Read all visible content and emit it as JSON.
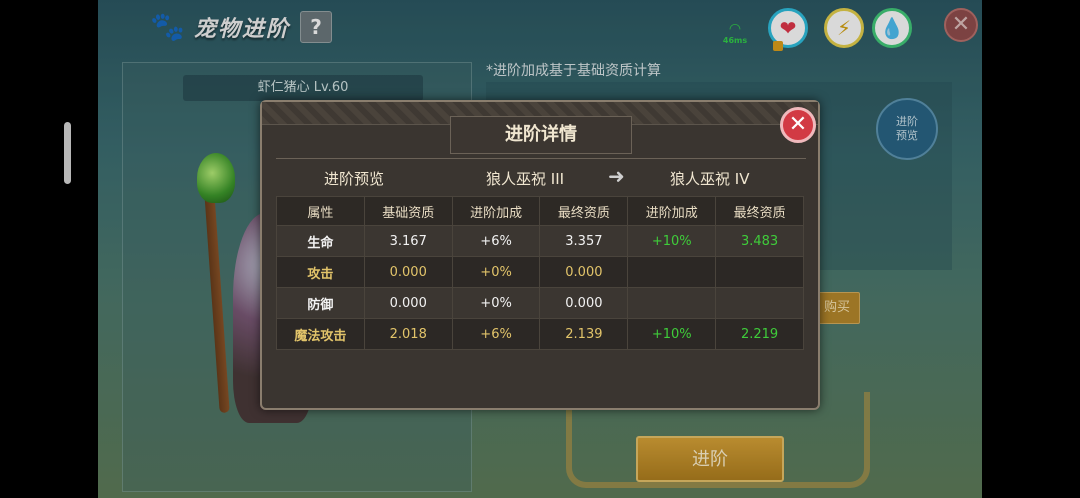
{
  "header": {
    "title": "宠物进阶",
    "help_label": "?",
    "ping": "46ms"
  },
  "status_icons": [
    "heart-icon",
    "lightning-icon",
    "water-drop-icon"
  ],
  "close_label": "✕",
  "pet_panel": {
    "name": "虾仁猪心 Lv.60"
  },
  "background": {
    "note": "*进阶加成基于基础资质计算",
    "preview_button": "进阶\n预览",
    "buy_button": "购买",
    "advance_button": "进阶"
  },
  "modal": {
    "title": "进阶详情",
    "close_label": "✕",
    "preview_label": "进阶预览",
    "from_rank": "狼人巫祝 III",
    "to_rank": "狼人巫祝 IV",
    "columns": [
      "属性",
      "基础资质",
      "进阶加成",
      "最终资质",
      "进阶加成",
      "最终资质"
    ],
    "rows": [
      {
        "attr": "生命",
        "base": "3.167",
        "bonus_now": "+6%",
        "final_now": "3.357",
        "bonus_next": "+10%",
        "final_next": "3.483"
      },
      {
        "attr": "攻击",
        "base": "0.000",
        "bonus_now": "+0%",
        "final_now": "0.000",
        "bonus_next": "",
        "final_next": ""
      },
      {
        "attr": "防御",
        "base": "0.000",
        "bonus_now": "+0%",
        "final_now": "0.000",
        "bonus_next": "",
        "final_next": ""
      },
      {
        "attr": "魔法攻击",
        "base": "2.018",
        "bonus_now": "+6%",
        "final_now": "2.139",
        "bonus_next": "+10%",
        "final_next": "2.219"
      }
    ]
  },
  "colors": {
    "positive": "#3fcc3a",
    "accent_gold": "#e2c46a",
    "close_red": "#d23a44"
  }
}
